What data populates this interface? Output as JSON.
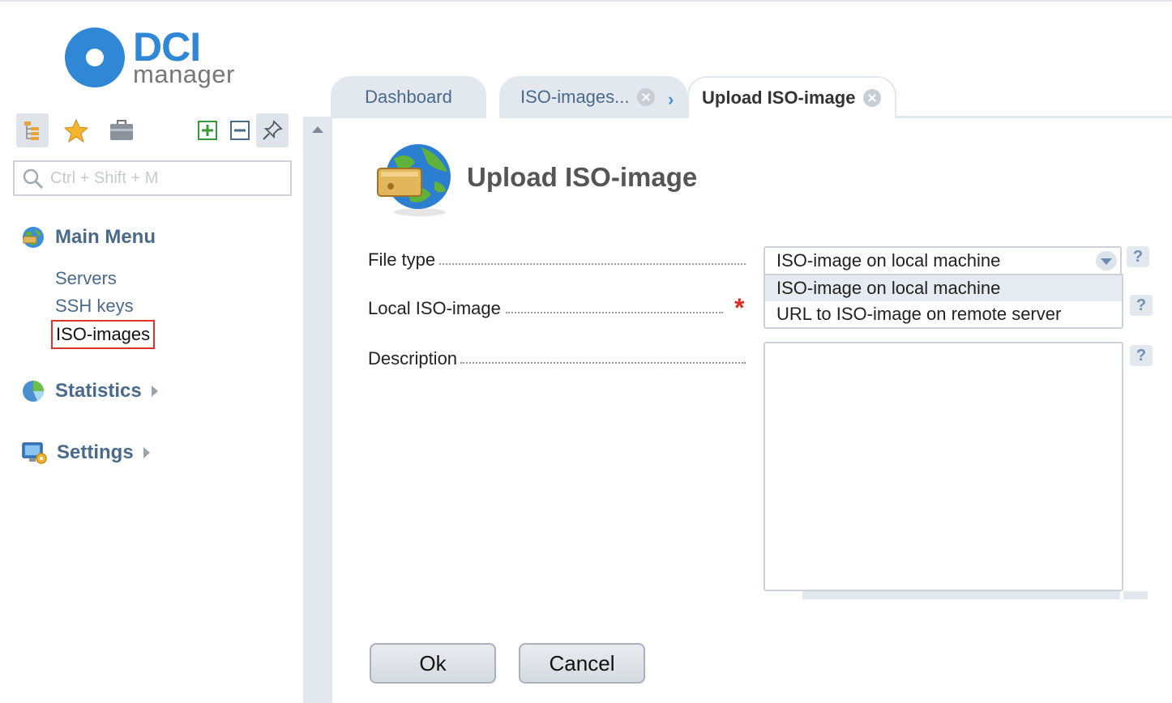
{
  "logo": {
    "brand": "DCI",
    "product": "manager"
  },
  "sidebar": {
    "search_placeholder": "Ctrl + Shift + M",
    "sections": [
      {
        "label": "Main Menu",
        "items": [
          "Servers",
          "SSH keys",
          "ISO-images"
        ],
        "selected": "ISO-images"
      },
      {
        "label": "Statistics"
      },
      {
        "label": "Settings"
      }
    ]
  },
  "tabs": [
    {
      "label": "Dashboard"
    },
    {
      "label": "ISO-images..."
    },
    {
      "label": "Upload ISO-image"
    }
  ],
  "form": {
    "title": "Upload ISO-image",
    "fields": {
      "file_type": {
        "label": "File type",
        "value": "ISO-image on local machine",
        "options": [
          "ISO-image on local machine",
          "URL to ISO-image on remote server"
        ]
      },
      "local_iso": {
        "label": "Local ISO-image",
        "required_mark": "*"
      },
      "description": {
        "label": "Description",
        "value": ""
      }
    },
    "help_glyph": "?",
    "ok_label": "Ok",
    "cancel_label": "Cancel"
  },
  "colors": {
    "accent": "#2f87d6",
    "nav_text": "#4a6a8c",
    "required": "#e02a1f",
    "selected_border": "#d9352c"
  }
}
